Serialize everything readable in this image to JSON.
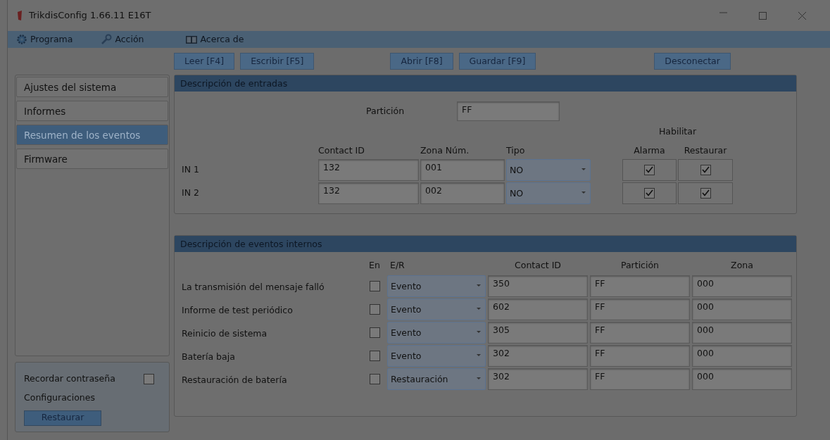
{
  "window": {
    "title": "TrikdisConfig 1.66.11   E16T"
  },
  "menu": [
    {
      "label": "Programa"
    },
    {
      "label": "Acción"
    },
    {
      "label": "Acerca de"
    }
  ],
  "toolbar": [
    [
      {
        "label": "Leer [F4]"
      },
      {
        "label": "Escribir [F5]"
      }
    ],
    [
      {
        "label": "Abrir [F8]"
      },
      {
        "label": "Guardar [F9]"
      }
    ],
    [
      {
        "label": "Desconectar"
      }
    ]
  ],
  "sidebar": {
    "items": [
      {
        "label": "Ajustes del sistema",
        "selected": false
      },
      {
        "label": "Informes",
        "selected": false
      },
      {
        "label": "Resumen de los eventos",
        "selected": true
      },
      {
        "label": "Firmware",
        "selected": false
      }
    ],
    "remember_password": {
      "label": "Recordar contraseña",
      "checked": false
    },
    "configurations": {
      "label": "Configuraciones",
      "button": "Restaurar"
    }
  },
  "inputs_section": {
    "title": "Descripción de entradas",
    "partition": {
      "label": "Partición",
      "value": "FF"
    },
    "enable_header": "Habilitar",
    "columns": [
      "Contact ID",
      "Zona Núm.",
      "Tipo",
      "Alarma",
      "Restaurar"
    ],
    "rows": [
      {
        "label": "IN 1",
        "contact_id": "132",
        "zone": "001",
        "type": "NO",
        "alarm": true,
        "restore": true
      },
      {
        "label": "IN 2",
        "contact_id": "132",
        "zone": "002",
        "type": "NO",
        "alarm": true,
        "restore": true
      }
    ]
  },
  "events_section": {
    "title": "Descripción de eventos internos",
    "columns": [
      "En",
      "E/R",
      "Contact ID",
      "Partición",
      "Zona"
    ],
    "rows": [
      {
        "label": "La transmisión del mensaje falló",
        "enabled": false,
        "er": "Evento",
        "contact_id": "350",
        "partition": "FF",
        "zone": "000"
      },
      {
        "label": "Informe de test periódico",
        "enabled": false,
        "er": "Evento",
        "contact_id": "602",
        "partition": "FF",
        "zone": "000"
      },
      {
        "label": "Reinicio de sistema",
        "enabled": false,
        "er": "Evento",
        "contact_id": "305",
        "partition": "FF",
        "zone": "000"
      },
      {
        "label": "Batería baja",
        "enabled": false,
        "er": "Evento",
        "contact_id": "302",
        "partition": "FF",
        "zone": "000"
      },
      {
        "label": "Restauración de batería",
        "enabled": false,
        "er": "Restauración",
        "contact_id": "302",
        "partition": "FF",
        "zone": "000"
      }
    ]
  }
}
